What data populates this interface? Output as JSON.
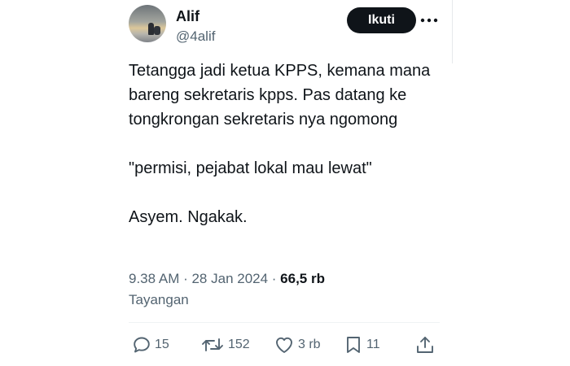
{
  "author": {
    "name": "Alif",
    "handle": "@4alif"
  },
  "follow_label": "Ikuti",
  "more_label": "•••",
  "tweet": {
    "lines": [
      "Tetangga jadi ketua KPPS, kemana mana bareng sekretaris kpps. Pas datang ke tongkrongan sekretaris nya ngomong",
      "\"permisi, pejabat lokal mau lewat\"",
      "Asyem. Ngakak."
    ]
  },
  "meta": {
    "timestamp": "9.38 AM · 28 Jan 2024 · ",
    "views": "66,5 rb",
    "views_label": "Tayangan"
  },
  "actions": {
    "replies": "15",
    "reposts": "152",
    "likes": "3 rb",
    "bookmarks": "11"
  },
  "colors": {
    "text": "#0f1419",
    "secondary": "#536471",
    "button": "#0f1419"
  },
  "icons": [
    "reply-icon",
    "repost-icon",
    "like-icon",
    "bookmark-icon",
    "share-icon",
    "more-icon"
  ]
}
